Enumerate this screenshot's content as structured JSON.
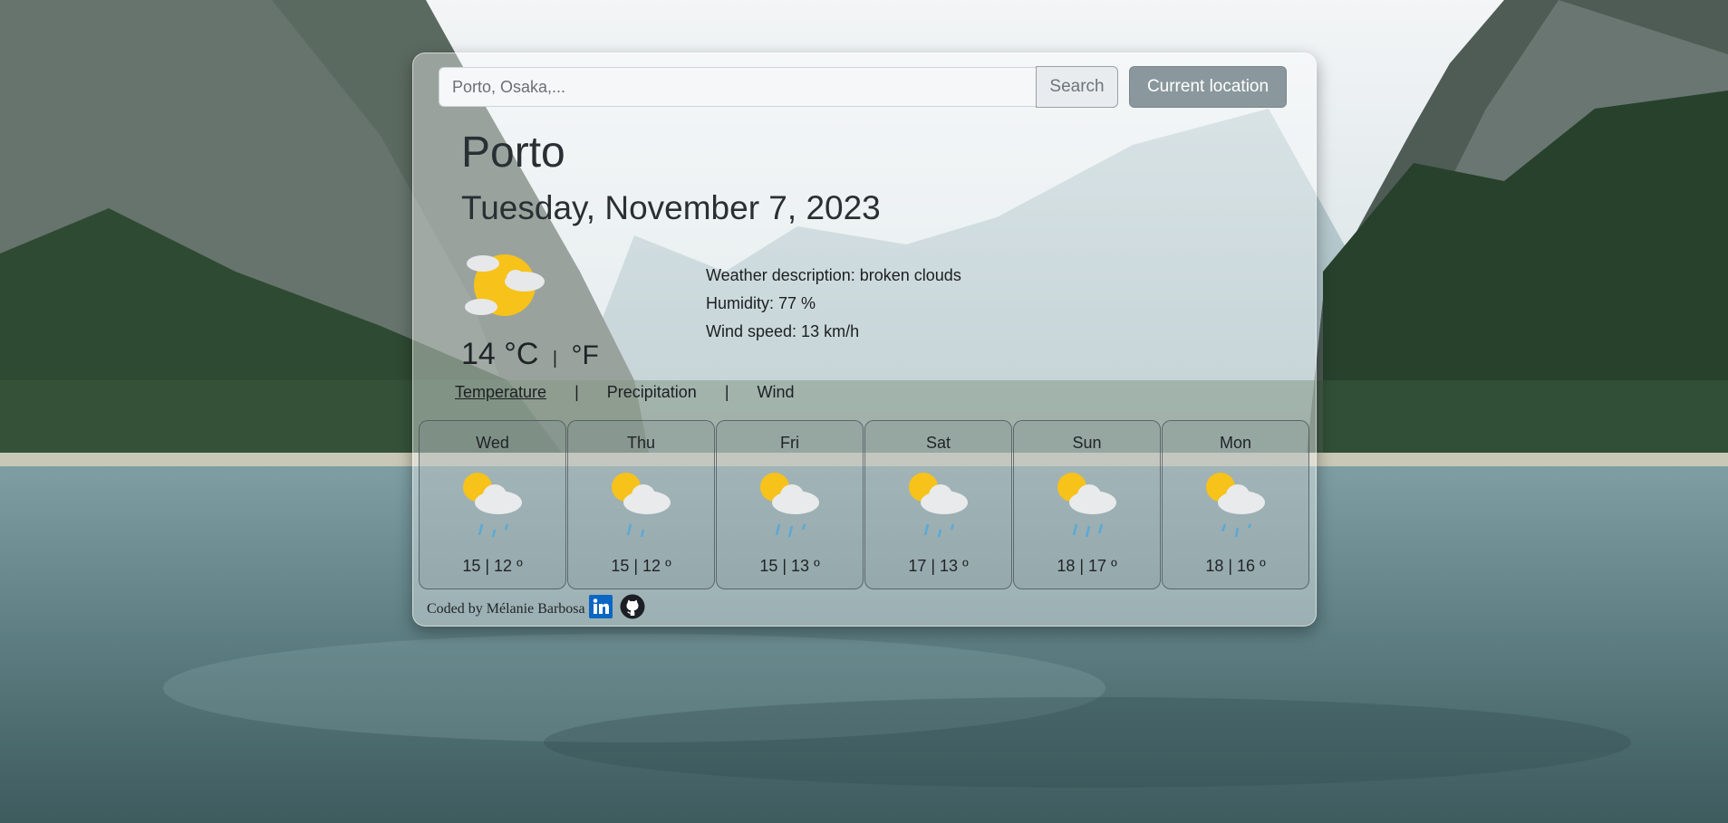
{
  "search": {
    "placeholder": "Porto, Osaka,...",
    "value": "",
    "search_label": "Search",
    "location_label": "Current location"
  },
  "weather": {
    "city": "Porto",
    "date": "Tuesday, November 7, 2023",
    "icon": "sun-behind-clouds-icon",
    "temperature": "14",
    "unit_c": "°C",
    "separator": "|",
    "unit_f": "°F",
    "description": "Weather description: broken clouds",
    "humidity": "Humidity: 77 %",
    "wind": "Wind speed: 13 km/h"
  },
  "tabs": [
    {
      "label": "Temperature",
      "active": true
    },
    {
      "label": "Precipitation",
      "active": false
    },
    {
      "label": "Wind",
      "active": false
    }
  ],
  "tab_separator": "|",
  "forecast": [
    {
      "day": "Wed",
      "range": "15 | 12 º",
      "icon": "sun-cloud-rain-icon"
    },
    {
      "day": "Thu",
      "range": "15 | 12 º",
      "icon": "sun-cloud-rain-icon"
    },
    {
      "day": "Fri",
      "range": "15 | 13 º",
      "icon": "sun-cloud-rain-icon"
    },
    {
      "day": "Sat",
      "range": "17 | 13 º",
      "icon": "sun-cloud-rain-icon"
    },
    {
      "day": "Sun",
      "range": "18 | 17 º",
      "icon": "sun-cloud-rain-icon"
    },
    {
      "day": "Mon",
      "range": "18 | 16 º",
      "icon": "sun-cloud-rain-icon"
    }
  ],
  "footer": {
    "credit": "Coded by Mélanie Barbosa",
    "linkedin_icon": "linkedin-icon",
    "github_icon": "github-icon"
  },
  "colors": {
    "sun": "#f7c21a",
    "cloud": "#e8eaec",
    "rain": "#5aa9d6",
    "linkedin": "#0a66c2",
    "button_secondary": "#8a989d"
  }
}
